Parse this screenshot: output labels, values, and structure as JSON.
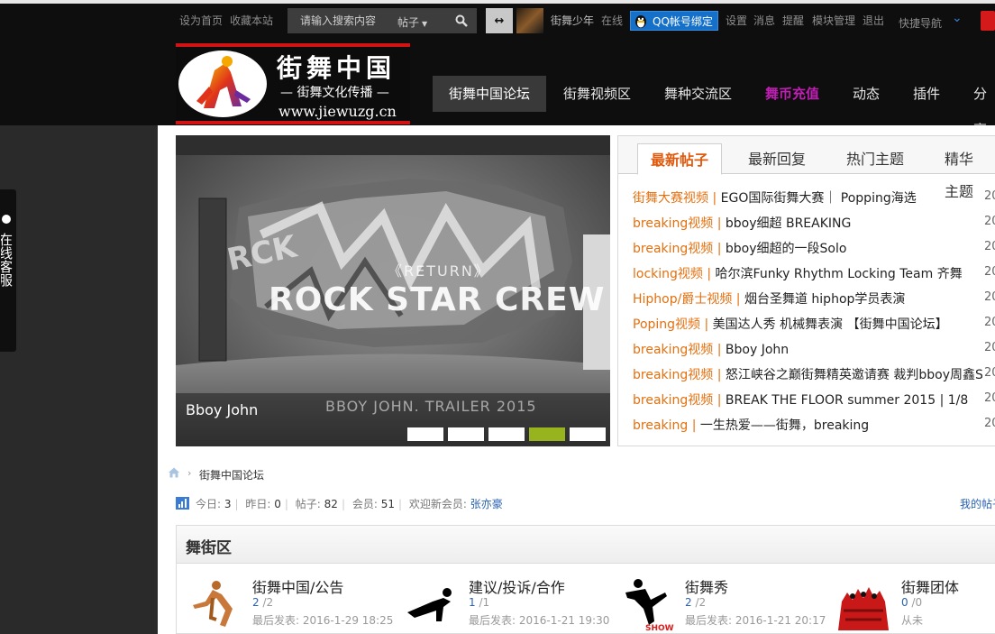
{
  "topbar": {
    "set_home": "设为首页",
    "bookmark": "收藏本站",
    "search_placeholder": "请输入搜索内容",
    "search_type": "帖子",
    "user_name": "街舞少年",
    "user_status": "在线",
    "qq_bind": "QQ帐号绑定",
    "links": [
      "设置",
      "消息",
      "提醒",
      "模块管理",
      "退出"
    ],
    "quick_nav": "快捷导航"
  },
  "logo": {
    "title": "街舞中国",
    "subtitle": "— 街舞文化传播 —",
    "url": "www.jiewuzg.cn"
  },
  "nav": [
    "街舞中国论坛",
    "街舞视频区",
    "舞种交流区",
    "舞币充值",
    "动态",
    "插件",
    "分享"
  ],
  "side_tab": "在线客服",
  "slider": {
    "graffiti_sub": "《RETURN》",
    "headline": "ROCK STAR CREW",
    "caption": "Bboy John",
    "trailer_text": "BBOY JOHN. TRAILER 2015",
    "active_dot": 4,
    "dot_count": 5
  },
  "posts_panel": {
    "tabs": [
      "最新帖子",
      "最新回复",
      "热门主题",
      "精华主题"
    ],
    "date_prefix": "20",
    "posts": [
      {
        "category": "街舞大赛视频 |",
        "title": " EGO国际街舞大赛｜ Popping海选"
      },
      {
        "category": "breaking视频 |",
        "title": " bboy细超 BREAKING"
      },
      {
        "category": "breaking视频 |",
        "title": " bboy细超的一段Solo"
      },
      {
        "category": "locking视频 |",
        "title": " 哈尔滨Funky Rhythm Locking Team 齐舞"
      },
      {
        "category": "Hiphop/爵士视频 |",
        "title": " 烟台圣舞道 hiphop学员表演"
      },
      {
        "category": "Poping视频 |",
        "title": " 美国达人秀 机械舞表演 【街舞中国论坛】"
      },
      {
        "category": "breaking视频 |",
        "title": " Bboy John"
      },
      {
        "category": "breaking视频 |",
        "title": " 怒江峡谷之巅街舞精英邀请赛 裁判bboy周鑫S"
      },
      {
        "category": "breaking视频 |",
        "title": " BREAK THE FLOOR summer 2015 | 1/8"
      },
      {
        "category": "breaking |",
        "title": " 一生热爱——街舞，breaking"
      }
    ]
  },
  "breadcrumb": {
    "current": "街舞中国论坛"
  },
  "stats": {
    "today_label": "今日:",
    "today": "3",
    "yesterday_label": "昨日:",
    "yesterday": "0",
    "posts_label": "帖子:",
    "posts": "82",
    "members_label": "会员:",
    "members": "51",
    "welcome_label": "欢迎新会员:",
    "new_member": "张亦豪",
    "my_posts": "我的帖子"
  },
  "section": {
    "title": "舞街区",
    "forums": [
      {
        "name": "街舞中国/公告",
        "threads": "2",
        "posts": "/2",
        "last": "最后发表: 2016-1-29 18:25"
      },
      {
        "name": "建议/投诉/合作",
        "threads": "1",
        "posts": "/1",
        "last": "最后发表: 2016-1-21 19:30"
      },
      {
        "name": "街舞秀",
        "threads": "2",
        "posts": "/2",
        "last": "最后发表: 2016-1-21 20:17",
        "img_label": "SHOW"
      },
      {
        "name": "街舞团体",
        "threads": "0",
        "posts": "/0",
        "last": "从未"
      }
    ]
  },
  "colors": {
    "accent_orange": "#e4700f",
    "active_dot": "#97b41e",
    "nav_special": "#c01fb4",
    "logo_red": "#d21313",
    "link_blue": "#2a62b0"
  }
}
